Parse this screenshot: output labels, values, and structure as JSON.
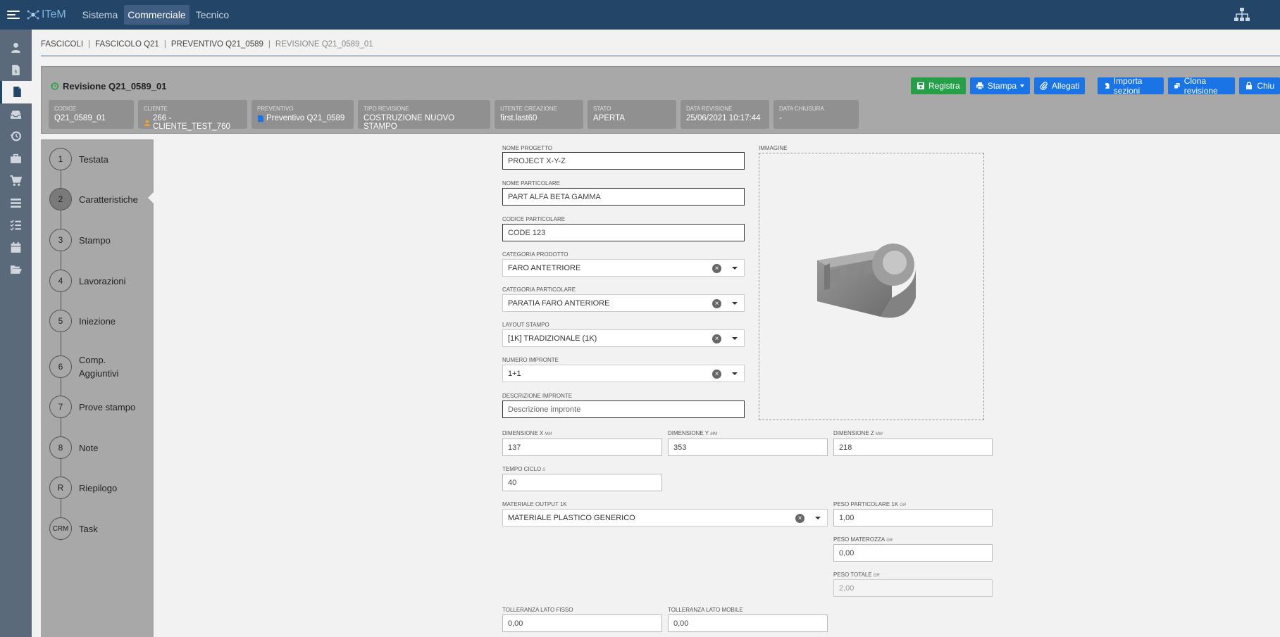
{
  "topbar": {
    "logo_text": "ITeM",
    "nav": [
      "Sistema",
      "Commerciale",
      "Tecnico"
    ],
    "active_nav": "Commerciale"
  },
  "rail_icons": [
    "user-icon",
    "invoice-icon",
    "document-icon",
    "inbox-icon",
    "history-icon",
    "briefcase-icon",
    "cart-icon",
    "list-icon",
    "checklist-icon",
    "calendar-icon",
    "folder-open-icon"
  ],
  "breadcrumb": [
    "FASCICOLI",
    "FASCICOLO Q21",
    "PREVENTIVO Q21_0589",
    "REVISIONE Q21_0589_01"
  ],
  "header": {
    "title": "Revisione Q21_0589_01",
    "buttons": {
      "registra": "Registra",
      "stampa": "Stampa",
      "allegati": "Allegati",
      "importa": "Importa sezioni",
      "clona": "Clona revisione",
      "chiudi": "Chiu"
    },
    "cards": [
      {
        "label": "CODICE",
        "value": "Q21_0589_01"
      },
      {
        "label": "CLIENTE",
        "value": "266 - CLIENTE_TEST_760"
      },
      {
        "label": "PREVENTIVO",
        "value": "Preventivo Q21_0589"
      },
      {
        "label": "TIPO REVISIONE",
        "value": "COSTRUZIONE NUOVO STAMPO"
      },
      {
        "label": "UTENTE CREAZIONE",
        "value": "first.last60"
      },
      {
        "label": "STATO",
        "value": "APERTA"
      },
      {
        "label": "DATA REVISIONE",
        "value": "25/06/2021 10:17:44"
      },
      {
        "label": "DATA CHIUSURA",
        "value": "-"
      }
    ]
  },
  "steps": [
    {
      "num": "1",
      "label": "Testata"
    },
    {
      "num": "2",
      "label": "Caratteristiche"
    },
    {
      "num": "3",
      "label": "Stampo"
    },
    {
      "num": "4",
      "label": "Lavorazioni"
    },
    {
      "num": "5",
      "label": "Iniezione"
    },
    {
      "num": "6",
      "label": "Comp. Aggiuntivi"
    },
    {
      "num": "7",
      "label": "Prove stampo"
    },
    {
      "num": "8",
      "label": "Note"
    },
    {
      "num": "R",
      "label": "Riepilogo"
    },
    {
      "num": "CRM",
      "label": "Task"
    }
  ],
  "active_step": "2",
  "form": {
    "nome_progetto": {
      "label": "NOME PROGETTO",
      "value": "PROJECT X-Y-Z"
    },
    "nome_particolare": {
      "label": "NOME PARTICOLARE",
      "value": "PART ALFA BETA GAMMA"
    },
    "codice_particolare": {
      "label": "CODICE PARTICOLARE",
      "value": "CODE 123"
    },
    "categoria_prodotto": {
      "label": "CATEGORIA PRODOTTO",
      "value": "FARO ANTETRIORE"
    },
    "categoria_particolare": {
      "label": "CATEGORIA PARTICOLARE",
      "value": "PARATIA FARO ANTERIORE"
    },
    "layout_stampo": {
      "label": "LAYOUT STAMPO",
      "value": "[1K] TRADIZIONALE (1K)"
    },
    "numero_impronte": {
      "label": "NUMERO IMPRONTE",
      "value": "1+1"
    },
    "descrizione_impronte": {
      "label": "DESCRIZIONE IMPRONTE",
      "placeholder": "Descrizione impronte"
    },
    "immagine": {
      "label": "IMMAGINE"
    },
    "dim_x": {
      "label": "DIMENSIONE X",
      "unit": "MM",
      "value": "137"
    },
    "dim_y": {
      "label": "DIMENSIONE Y",
      "unit": "MM",
      "value": "353"
    },
    "dim_z": {
      "label": "DIMENSIONE Z",
      "unit": "MM",
      "value": "218"
    },
    "tempo_ciclo": {
      "label": "TEMPO CICLO",
      "unit": "S",
      "value": "40"
    },
    "materiale": {
      "label": "MATERIALE OUTPUT 1K",
      "value": "MATERIALE PLASTICO GENERICO"
    },
    "peso_particolare": {
      "label": "PESO PARTICOLARE 1K",
      "unit": "GR",
      "value": "1,00"
    },
    "peso_materozza": {
      "label": "PESO MATEROZZA",
      "unit": "GR",
      "value": "0,00"
    },
    "peso_totale": {
      "label": "PESO TOTALE",
      "unit": "GR",
      "value": "2,00"
    },
    "toll_fisso": {
      "label": "TOLLERANZA LATO FISSO",
      "value": "0,00"
    },
    "toll_mobile": {
      "label": "TOLLERANZA LATO MOBILE",
      "value": "0,00"
    }
  }
}
